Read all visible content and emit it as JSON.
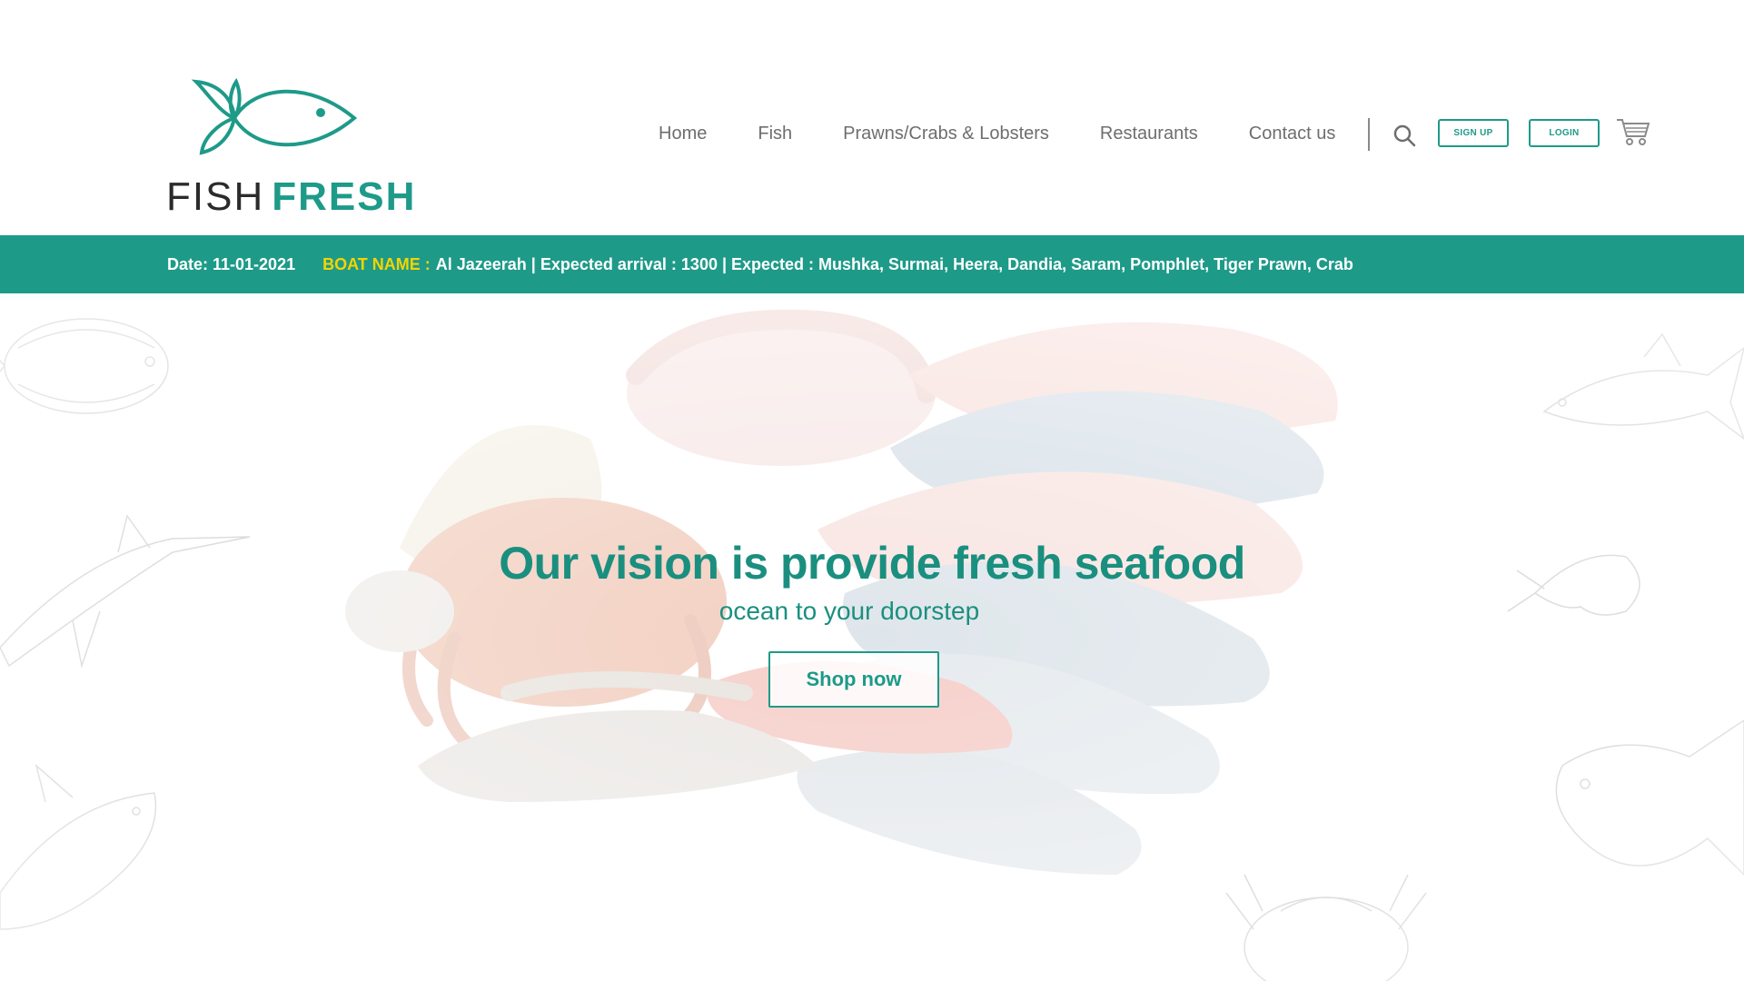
{
  "brand": {
    "word1": "FISH",
    "word2": "FRESH",
    "accent_color": "#1e9a88"
  },
  "nav": {
    "items": [
      {
        "label": "Home"
      },
      {
        "label": "Fish"
      },
      {
        "label": "Prawns/Crabs & Lobsters"
      },
      {
        "label": "Restaurants"
      },
      {
        "label": "Contact us"
      }
    ],
    "search_icon": "search-icon",
    "signup_label": "SIGN UP",
    "login_label": "LOGIN",
    "cart_icon": "cart-icon"
  },
  "boat_strip": {
    "date": "Date: 11-01-2021",
    "boat_label": "BOAT NAME :",
    "boat_info": "Al Jazeerah | Expected arrival : 1300 | Expected : Mushka, Surmai, Heera, Dandia, Saram, Pomphlet, Tiger Prawn, Crab",
    "label_color": "#f5d400",
    "background_color": "#1e9a88"
  },
  "hero": {
    "headline": "Our vision is provide fresh seafood",
    "subline": "ocean to your doorstep",
    "cta_label": "Shop now",
    "text_color": "#1a8f7f"
  }
}
